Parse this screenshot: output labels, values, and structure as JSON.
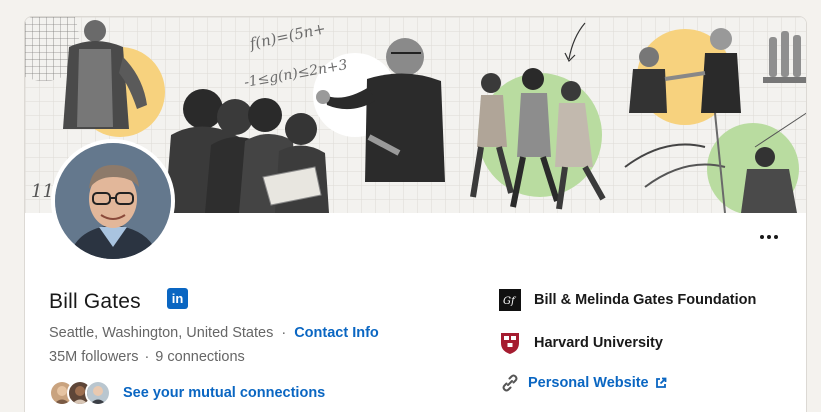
{
  "profile": {
    "name": "Bill Gates",
    "badge_label": "in",
    "location": "Seattle, Washington, United States",
    "separator": "·",
    "contact_label": "Contact Info",
    "followers": "35M followers",
    "connections": "9 connections",
    "mutual_label": "See your mutual connections"
  },
  "sidebar": {
    "items": [
      {
        "label": "Bill & Melinda Gates Foundation",
        "icon": "foundation-logo-icon",
        "monogram": "Gf"
      },
      {
        "label": "Harvard University",
        "icon": "harvard-shield-icon"
      },
      {
        "label": "Personal Website",
        "icon": "link-icon"
      }
    ]
  },
  "banner": {
    "math_line_1": "f(n)=(5n+",
    "math_line_2": "-1≤g(n)≤2n+3",
    "tally": "11"
  },
  "colors": {
    "link_blue": "#0a66c2",
    "banner_yellow": "#f7d27e",
    "banner_green": "#b9dca0",
    "text_primary": "#191919",
    "text_secondary": "#666666"
  }
}
